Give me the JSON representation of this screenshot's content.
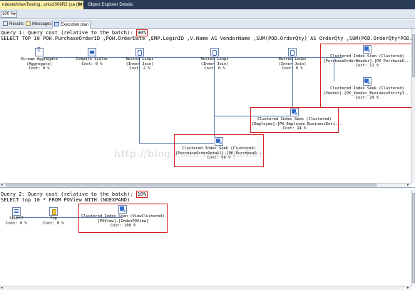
{
  "window": {
    "tab_query": "ndexedViewTesting...orks2008R2 (sa (54))*",
    "tab_close": "✕",
    "tab_object_explorer": "Object Explorer Details"
  },
  "toolbar": {
    "zoom_value": "100 %",
    "zoom_arrow": "▾"
  },
  "result_tabs": [
    {
      "label": "Results",
      "icon": "grid-icon"
    },
    {
      "label": "Messages",
      "icon": "messages-icon"
    },
    {
      "label": "Execution plan",
      "icon": "execution-plan-icon"
    }
  ],
  "query1": {
    "header_prefix": "Query 1: Query cost (relative to the batch):",
    "cost_percent": "90%",
    "sql": "SELECT TOP 10 POH.PurchaseOrderID ,POH.OrderDate ,EMP.LoginID ,V.Name AS VendorName ,SUM(POD.OrderQty) AS OrderQty ,SUM(POD.OrderQty*POD.UnitPr",
    "nodes": {
      "stream_aggregate": {
        "name": "Stream Aggregate",
        "sub": "(Aggregate)",
        "cost": "Cost: 0 %"
      },
      "compute_scalar": {
        "name": "Compute Scalar",
        "cost": "Cost: 0 %"
      },
      "nested_loops_1": {
        "name": "Nested Loops",
        "sub": "(Inner Join)",
        "cost": "Cost: 2 %"
      },
      "nested_loops_2": {
        "name": "Nested Loops",
        "sub": "(Inner Join)",
        "cost": "Cost: 0 %"
      },
      "nested_loops_3": {
        "name": "Nested Loops",
        "sub": "(Inner Join)",
        "cost": "Cost: 0 %"
      },
      "scan_poheader": {
        "name": "Clustered Index Scan (Clustered)",
        "sub": "[PurchaseOrderHeader].[PK_PurchaseO...",
        "cost": "Cost: 11 %"
      },
      "seek_vendor": {
        "name": "Clustered Index Seek (Clustered)",
        "sub": "[Vendor].[PK_Vendor_BusinessEntityI...",
        "cost": "Cost: 29 %"
      },
      "seek_employee": {
        "name": "Clustered Index Seek (Clustered)",
        "sub": "[Employee].[PK_Employee_BusinessEnti...",
        "cost": "Cost: 14 %"
      },
      "seek_podetail": {
        "name": "Clustered Index Seek (Clustered)",
        "sub": "[PurchaseOrderDetail].[PK_PurchaseO...",
        "cost": "Cost: 50 %"
      }
    }
  },
  "query2": {
    "header_prefix": "Query 2: Query cost (relative to the batch):",
    "cost_percent": "10%",
    "sql": "SELECT top 10 * FROM POView WITH (NOEXPAND)",
    "nodes": {
      "select": {
        "name": "SELECT",
        "cost": "Cost: 0 %"
      },
      "top": {
        "name": "Top",
        "cost": "Cost: 0 %"
      },
      "scan_view": {
        "name": "Clustered Index Scan (ViewClustered)",
        "sub": "[POView].[IndexPOView]",
        "cost": "Cost: 100 %"
      }
    }
  },
  "watermark": "http://blog.csdn.net/sqlchen",
  "colors": {
    "highlight": "#d42020",
    "tabstrip": "#2b3c59",
    "active_tab": "#fff1a8"
  }
}
